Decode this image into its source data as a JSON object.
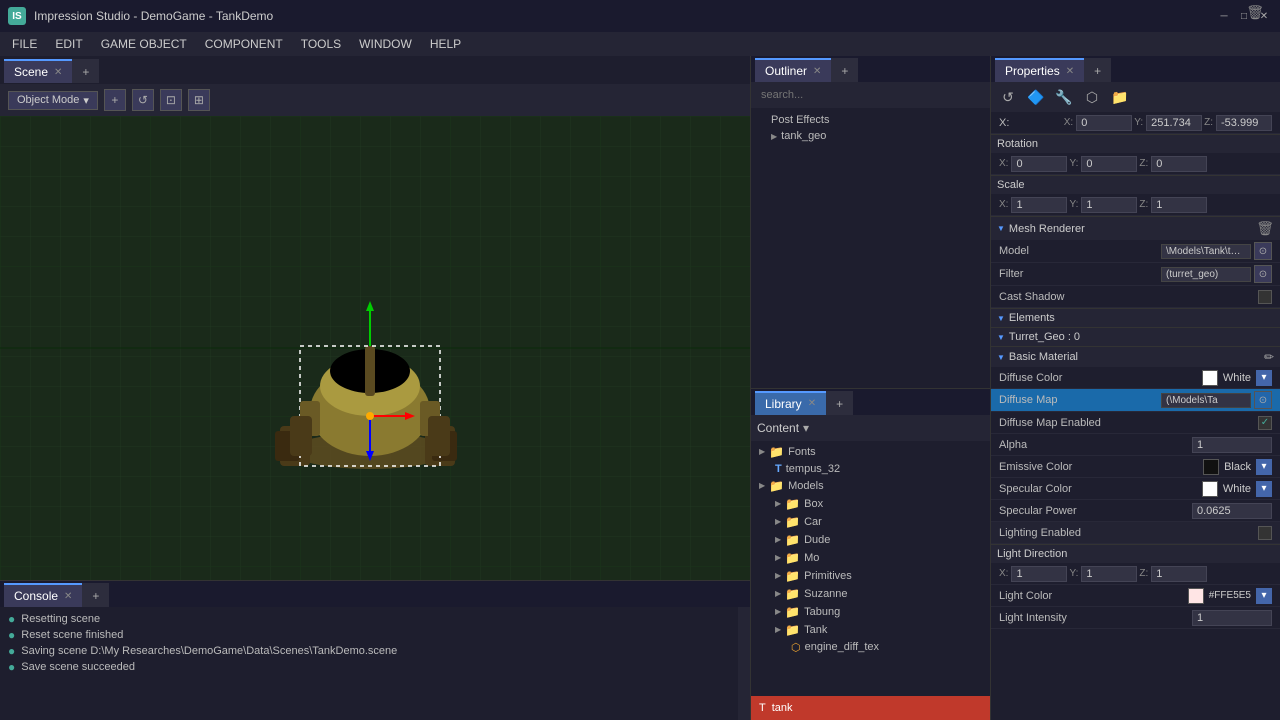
{
  "titleBar": {
    "appIcon": "IS",
    "title": "Impression Studio - DemoGame - TankDemo",
    "minimizeIcon": "─",
    "maximizeIcon": "□",
    "closeIcon": "✕"
  },
  "menuBar": {
    "items": [
      "FILE",
      "EDIT",
      "GAME OBJECT",
      "COMPONENT",
      "TOOLS",
      "WINDOW",
      "HELP"
    ]
  },
  "viewport": {
    "tabLabel": "Scene",
    "modeLabel": "Object Mode",
    "modeArrow": "▾",
    "addIcon": "+",
    "refreshIcon": "↺",
    "selectIcon": "⊡",
    "gridIcon": "⊞"
  },
  "outliner": {
    "tabLabel": "Outliner",
    "searchPlaceholder": "search...",
    "items": [
      {
        "label": "Post Effects",
        "indent": 0,
        "tri": "",
        "type": "item"
      },
      {
        "label": "tank_geo",
        "indent": 1,
        "tri": "▶",
        "type": "item"
      }
    ]
  },
  "library": {
    "tabLabel": "Library",
    "contentLabel": "Content",
    "filterArrow": "▾",
    "items": [
      {
        "label": "Fonts",
        "indent": 1,
        "tri": "▶",
        "type": "folder"
      },
      {
        "label": "tempus_32",
        "indent": 2,
        "tri": "",
        "type": "font"
      },
      {
        "label": "Models",
        "indent": 1,
        "tri": "▶",
        "type": "folder"
      },
      {
        "label": "Box",
        "indent": 2,
        "tri": "▶",
        "type": "folder"
      },
      {
        "label": "Car",
        "indent": 2,
        "tri": "▶",
        "type": "folder"
      },
      {
        "label": "Dude",
        "indent": 2,
        "tri": "▶",
        "type": "folder"
      },
      {
        "label": "Mo",
        "indent": 2,
        "tri": "▶",
        "type": "folder"
      },
      {
        "label": "Primitives",
        "indent": 2,
        "tri": "▶",
        "type": "folder"
      },
      {
        "label": "Suzanne",
        "indent": 2,
        "tri": "▶",
        "type": "folder"
      },
      {
        "label": "Tabung",
        "indent": 2,
        "tri": "▶",
        "type": "folder"
      },
      {
        "label": "Tank",
        "indent": 2,
        "tri": "▶",
        "type": "folder"
      },
      {
        "label": "engine_diff_tex",
        "indent": 3,
        "tri": "",
        "type": "file"
      }
    ],
    "bottomLabel": "tank",
    "bottomIcon": "T"
  },
  "properties": {
    "tabLabel": "Properties",
    "coords": {
      "xLabel": "X:",
      "xVal": "0",
      "yLabel": "Y:",
      "yVal": "251.734",
      "zLabel": "Z:",
      "zVal": "-53.999"
    },
    "rotation": {
      "label": "Rotation",
      "xLabel": "X:",
      "xVal": "0",
      "yLabel": "Y:",
      "yVal": "0",
      "zLabel": "Z:",
      "zVal": "0"
    },
    "scale": {
      "label": "Scale",
      "xLabel": "X:",
      "xVal": "1",
      "yLabel": "Y:",
      "yVal": "1",
      "zLabel": "Z:",
      "zVal": "1"
    },
    "meshRenderer": {
      "label": "Mesh Renderer",
      "modelLabel": "Model",
      "modelValue": "\\Models\\Tank\\tank",
      "filterLabel": "Filter",
      "filterValue": "(turret_geo)",
      "castShadowLabel": "Cast Shadow"
    },
    "elements": {
      "label": "Elements"
    },
    "turretGeo": {
      "label": "Turret_Geo : 0"
    },
    "basicMaterial": {
      "label": "Basic Material",
      "diffuseColorLabel": "Diffuse Color",
      "diffuseColorSwatch": "#ffffff",
      "diffuseColorValue": "White",
      "diffuseMapLabel": "Diffuse Map",
      "diffuseMapValue": "(\\Models\\Ta",
      "diffuseMapEnabled": "Diffuse Map Enabled",
      "diffuseMapChecked": true,
      "alphaLabel": "Alpha",
      "alphaValue": "1",
      "emissiveColorLabel": "Emissive Color",
      "emissiveColorSwatch": "#111111",
      "emissiveColorValue": "Black",
      "specularColorLabel": "Specular Color",
      "specularColorSwatch": "#ffffff",
      "specularColorValue": "White",
      "specularPowerLabel": "Specular Power",
      "specularPowerValue": "0.0625",
      "lightingEnabledLabel": "Lighting Enabled",
      "lightingEnabledChecked": false,
      "lightDirectionLabel": "Light Direction",
      "lightDirX": "1",
      "lightDirY": "1",
      "lightDirZ": "1",
      "lightColorLabel": "Light Color",
      "lightColorSwatch": "#FFE5E5",
      "lightColorValue": "#FFE5E5",
      "lightIntensityLabel": "Light Intensity",
      "lightIntensityValue": "1"
    }
  },
  "console": {
    "tabLabel": "Console",
    "lines": [
      {
        "icon": "●",
        "type": "ok",
        "text": "Resetting scene"
      },
      {
        "icon": "●",
        "type": "ok",
        "text": "Reset scene finished"
      },
      {
        "icon": "●",
        "type": "ok",
        "text": "Saving scene D:\\My Researches\\DemoGame\\Data\\Scenes\\TankDemo.scene"
      },
      {
        "icon": "●",
        "type": "ok",
        "text": "Save scene succeeded"
      }
    ]
  },
  "icons": {
    "close": "✕",
    "add": "+",
    "refresh": "↺",
    "triangle_right": "▶",
    "triangle_down": "▼",
    "chevron_down": "▾",
    "search": "🔍",
    "folder": "📁",
    "font_t": "T",
    "gear": "⚙",
    "link": "🔗",
    "share": "⬡",
    "home": "⌂",
    "eye": "👁",
    "pen": "✏",
    "cursor": "↖",
    "move": "✛",
    "rotate": "↻",
    "delete": "🗑",
    "plus": "+",
    "circle_refresh": "↺",
    "box": "⊡"
  }
}
